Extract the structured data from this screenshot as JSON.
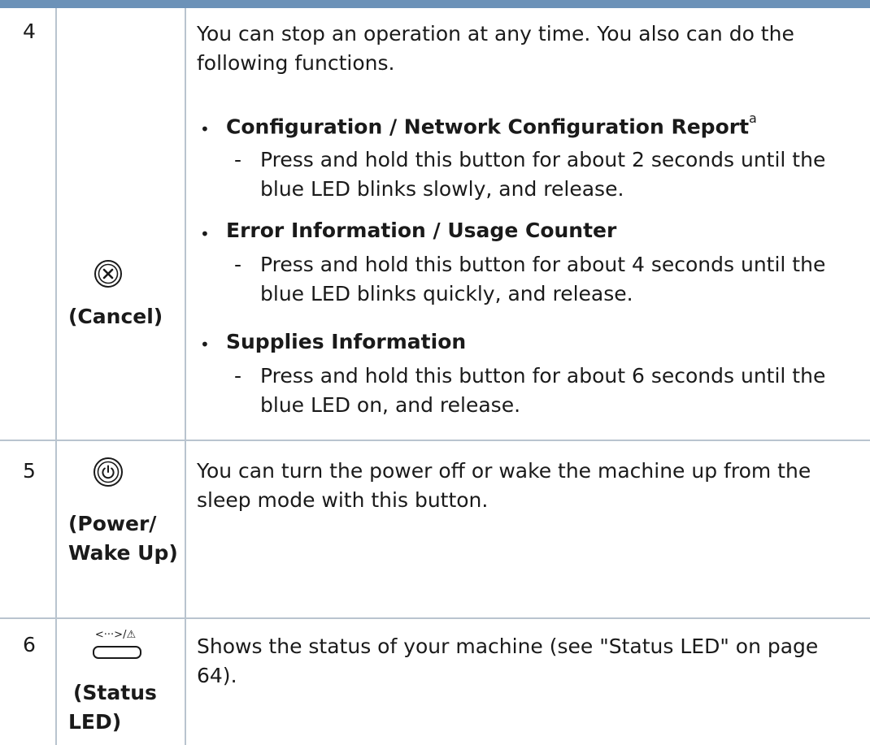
{
  "rows": [
    {
      "number": "4",
      "icon": "cancel-icon",
      "label": "(Cancel)",
      "description": "You can stop an operation at any time. You also can do the following functions.",
      "items": [
        {
          "title": "Configuration / Network Configuration Report",
          "footnote": "a",
          "text": "Press and hold this button for about 2 seconds until the blue LED blinks slowly, and release."
        },
        {
          "title": "Error Information / Usage Counter",
          "text": "Press and hold this button for about 4 seconds until the blue LED blinks quickly, and release."
        },
        {
          "title": "Supplies Information",
          "text": "Press and hold this button for about 6 seconds until the blue LED on, and release."
        }
      ]
    },
    {
      "number": "5",
      "icon": "power-icon",
      "label_line1": "(Power/",
      "label_line2": "Wake Up)",
      "description": "You can turn the power off or wake the machine up from the sleep mode with this button."
    },
    {
      "number": "6",
      "icon": "status-led-icon",
      "icon_text": "<···>/⚠",
      "label_line1": "(Status",
      "label_line2": "LED)",
      "description": "Shows the status of your machine (see \"Status LED\" on page 64)."
    }
  ],
  "bullet_char": "•",
  "dash_char": "-",
  "colors": {
    "accent_bar": "#6c92b8",
    "grid": "#b9c4cf",
    "text": "#1a1a1a"
  }
}
